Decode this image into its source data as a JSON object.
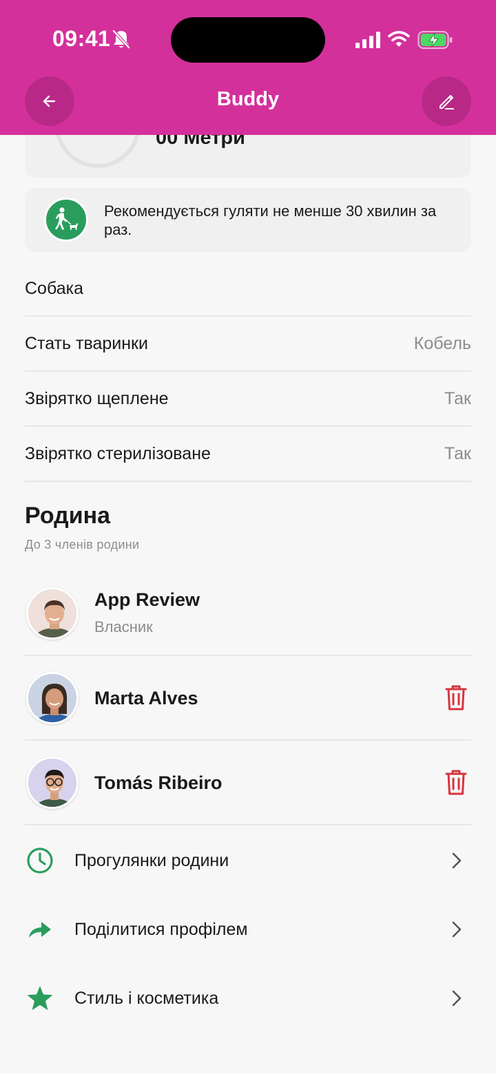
{
  "status_bar": {
    "time": "09:41"
  },
  "header": {
    "title": "Buddy",
    "background": "#d4309b"
  },
  "stats": {
    "distance_value": "00 Метри"
  },
  "tip": {
    "text": "Рекомендується гуляти не менше 30 хвилин за раз."
  },
  "pet_info": {
    "species_label": "Собака",
    "rows": [
      {
        "label": "Стать тваринки",
        "value": "Кобель"
      },
      {
        "label": "Звірятко щеплене",
        "value": "Так"
      },
      {
        "label": "Звірятко стерилізоване",
        "value": "Так"
      }
    ]
  },
  "family": {
    "title": "Родина",
    "subtitle": "До 3 членів родини",
    "members": [
      {
        "name": "App Review",
        "role": "Власник"
      },
      {
        "name": "Marta Alves"
      },
      {
        "name": "Tomás Ribeiro"
      }
    ]
  },
  "menu": {
    "items": [
      {
        "label": "Прогулянки родини",
        "icon": "clock-icon"
      },
      {
        "label": "Поділитися профілем",
        "icon": "share-arrow-icon"
      },
      {
        "label": "Стиль і косметика",
        "icon": "star-icon"
      }
    ]
  },
  "colors": {
    "accent_green": "#2a9d5c",
    "delete_red": "#d6343e",
    "muted_text": "#8c8c8c"
  }
}
